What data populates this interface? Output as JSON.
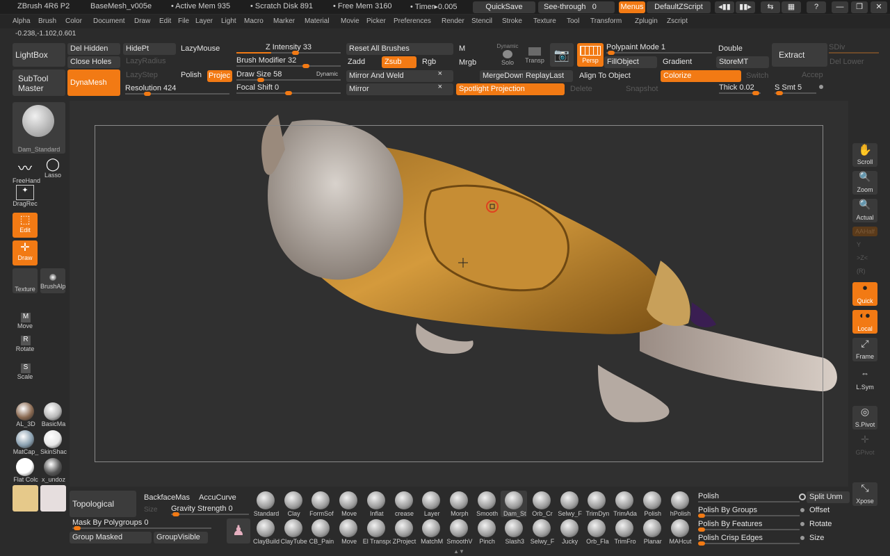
{
  "title_bar": {
    "app": "ZBrush 4R6 P2",
    "file": "BaseMesh_v005e",
    "active_mem": "• Active Mem 935",
    "scratch": "• Scratch Disk 891",
    "free_mem": "• Free Mem 3160",
    "timer": "• Timer▸0.005",
    "quicksave": "QuickSave",
    "seethrough": "See-through",
    "seethrough_val": "0",
    "menus": "Menus",
    "script": "DefaultZScript"
  },
  "menu_items": [
    "Alpha",
    "Brush",
    "Color",
    "Document",
    "Draw",
    "Edit",
    "File",
    "Layer",
    "Light",
    "Macro",
    "Marker",
    "Material",
    "Movie",
    "Picker",
    "Preferences",
    "Render",
    "Stencil",
    "Stroke",
    "Texture",
    "Tool",
    "Transform",
    "Zplugin",
    "Zscript"
  ],
  "coords": "-0.238,-1.102,0.601",
  "shelf": {
    "lightbox": "LightBox",
    "subtool_master": "SubTool Master",
    "del_hidden": "Del Hidden",
    "close_holes": "Close Holes",
    "hidept": "HidePt",
    "lazymouse": "LazyMouse",
    "lazyradius": "LazyRadius",
    "lazystep": "LazyStep",
    "polish": "Polish",
    "project": "Projec",
    "dynamesh": "DynaMesh",
    "resolution": "Resolution 424",
    "z_intensity": "Z Intensity 33",
    "brush_modifier": "Brush Modifier 32",
    "draw_size": "Draw Size 58",
    "dynamic": "Dynamic",
    "focal_shift": "Focal Shift 0",
    "reset_brushes": "Reset All Brushes",
    "zadd": "Zadd",
    "zsub": "Zsub",
    "rgb": "Rgb",
    "mirror_weld": "Mirror And Weld",
    "mirror": "Mirror",
    "m": "M",
    "mrgb": "Mrgb",
    "dynamic_solo": "Dynamic",
    "solo": "Solo",
    "transp": "Transp",
    "mergedown": "MergeDown",
    "replaylast": "ReplayLast",
    "persp": "Persp",
    "spotlight": "Spotlight Projection",
    "delete": "Delete",
    "snapshot": "Snapshot",
    "polypaint_mode": "Polypaint Mode 1",
    "fillobject": "FillObject",
    "gradient": "Gradient",
    "align": "Align To Object",
    "colorize": "Colorize",
    "switch": "Switch",
    "double": "Double",
    "storemt": "StoreMT",
    "thick": "Thick 0.02",
    "s_smt": "S Smt 5",
    "extract": "Extract",
    "sdiv": "SDiv",
    "del_lower": "Del Lower",
    "accept": "Accep"
  },
  "left_tray": {
    "brush_name": "Dam_Standard",
    "freehand": "FreeHand",
    "lasso": "Lasso",
    "dragrect": "DragRec",
    "edit": "Edit",
    "draw": "Draw",
    "texture": "Texture",
    "brushalpha": "BrushAlp",
    "move": "Move",
    "rotate": "Rotate",
    "scale": "Scale",
    "materials": [
      {
        "label": "AL_3D",
        "color": "#8a6a52"
      },
      {
        "label": "BasicMa",
        "color": "#b8b8b8"
      },
      {
        "label": "MatCap_",
        "color": "#8aa0b0"
      },
      {
        "label": "SkinShac",
        "color": "#e6e6e6"
      },
      {
        "label": "Flat Colc",
        "color": "#ffffff"
      },
      {
        "label": "x_undoz",
        "color": "#555555"
      }
    ],
    "color_main": "#e6c98a",
    "color_secondary": "#e6dede"
  },
  "right_tray": {
    "scroll": "Scroll",
    "zoom": "Zoom",
    "actual": "Actual",
    "aahalf": "AAHalf",
    "persp_y": "Y",
    "xyz": ">Z<",
    "r": "(R)",
    "quick": "Quick",
    "local": "Local",
    "frame": "Frame",
    "lsym": "L.Sym",
    "spivot": "S.Pivot",
    "gpivot": "GPivot",
    "xpose": "Xpose"
  },
  "bottom": {
    "topological": "Topological",
    "backface": "BackfaceMas",
    "accucurve": "AccuCurve",
    "size": "Size",
    "gravity": "Gravity Strength 0",
    "mask_polygroups": "Mask By Polygroups 0",
    "group_masked": "Group Masked",
    "groupvisible": "GroupVisible",
    "brushes_row1": [
      "Standard",
      "Clay",
      "FormSof",
      "Move",
      "Inflat",
      "crease",
      "Layer",
      "Morph",
      "Smooth",
      "Dam_St",
      "Orb_Cr",
      "Selwy_F",
      "TrimDyn",
      "TrimAda",
      "Polish",
      "hPolish"
    ],
    "brushes_row2": [
      "ClayBuild",
      "ClayTube",
      "CB_Pain",
      "Move",
      "El Transpo",
      "ZProject",
      "MatchM",
      "SmoothV",
      "Pinch",
      "Slash3",
      "Selwy_F",
      "Jucky",
      "Orb_Fla",
      "TrimFro",
      "Planar",
      "MAHcut"
    ],
    "polish": "Polish",
    "polish_groups": "Polish By Groups",
    "polish_features": "Polish By Features",
    "polish_crisp": "Polish Crisp Edges",
    "split": "Split Unm",
    "offset": "Offset",
    "rotate": "Rotate",
    "size2": "Size"
  }
}
